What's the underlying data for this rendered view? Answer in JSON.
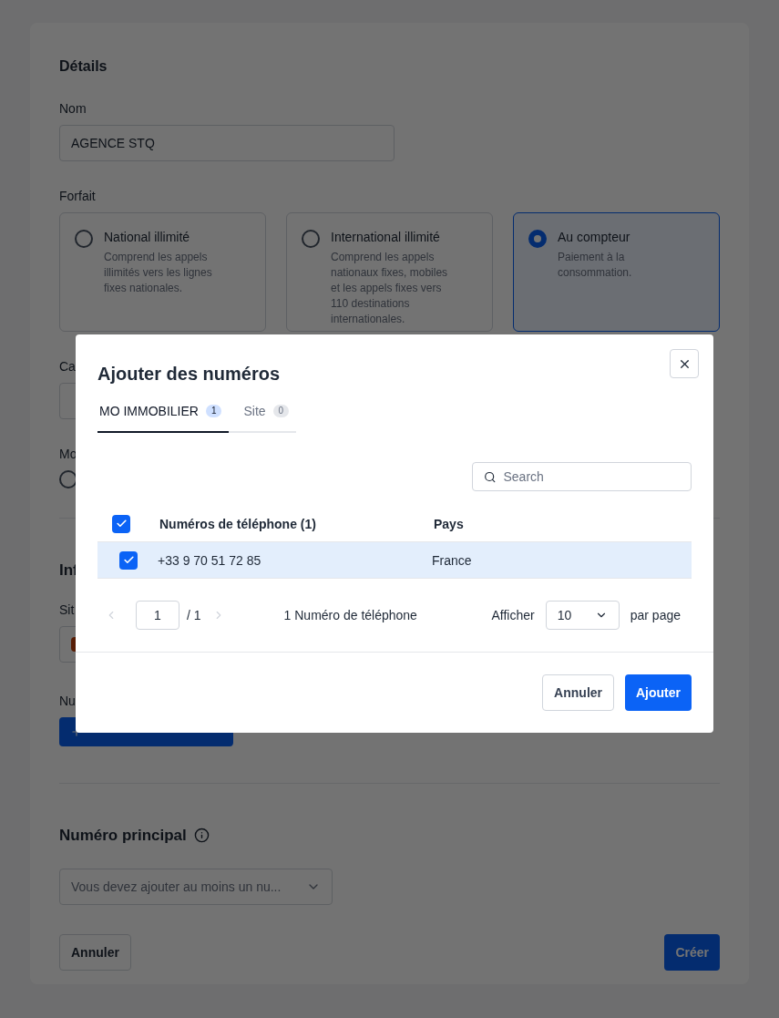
{
  "form": {
    "details_heading": "Détails",
    "name_label": "Nom",
    "name_value": "AGENCE STQ",
    "plan_label": "Forfait",
    "plans": [
      {
        "title": "National illimité",
        "description": "Comprend les appels illimités vers les lignes fixes nationales.",
        "selected": false
      },
      {
        "title": "International illimité",
        "description": "Comprend les appels nationaux fixes, mobiles et les appels fixes vers 110 destinations internationales.",
        "selected": false
      },
      {
        "title": "Au compteur",
        "description": "Paiement à la consommation.",
        "selected": true
      }
    ],
    "field_3_label": "Ca",
    "field_4_label": "Mo",
    "field_4_radio": {
      "selected": false
    },
    "section_2_heading": "Inf",
    "site_label": "Sit",
    "numbers_label": "Nu",
    "main_number_heading": "Numéro principal",
    "main_number_placeholder": "Vous devez ajouter au moins un nu...",
    "cancel": "Annuler",
    "create": "Créer"
  },
  "modal": {
    "title": "Ajouter des numéros",
    "tabs": [
      {
        "label": "MO IMMOBILIER",
        "count": "1",
        "selected": true
      },
      {
        "label": "Site",
        "count": "0",
        "selected": false
      }
    ],
    "search": {
      "placeholder": "Search"
    },
    "table": {
      "all_checked": true,
      "columns": [
        "Numéros de téléphone (1)",
        "Pays"
      ],
      "rows": [
        {
          "number": "+33 9 70 51 72 85",
          "country": "France",
          "checked": true
        }
      ]
    },
    "pagination": {
      "page": "1",
      "total": "/ 1",
      "summary": "1 Numéro de téléphone",
      "show_label": "Afficher",
      "page_size": "10",
      "per_page": "par page"
    },
    "cancel": "Annuler",
    "confirm": "Ajouter"
  }
}
